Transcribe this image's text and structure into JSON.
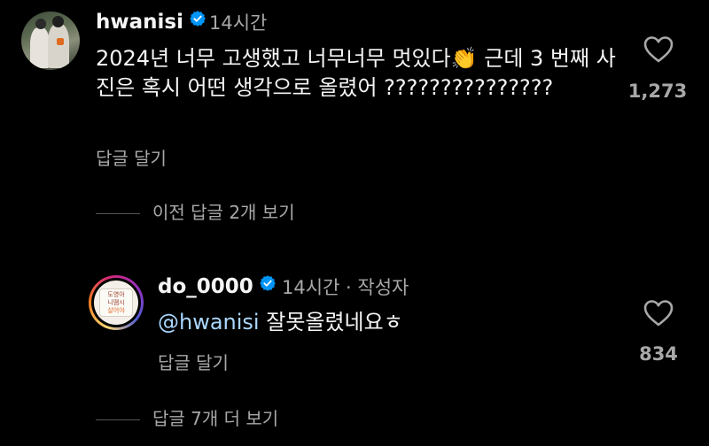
{
  "colors": {
    "background": "#000000",
    "text_primary": "#f5f5f5",
    "text_secondary": "#a8a8a8",
    "verified_badge": "#0095f6",
    "mention": "#aad7ff"
  },
  "comments": [
    {
      "username": "hwanisi",
      "verified": true,
      "time": "14시간",
      "text_before_emoji": "2024년 너무 고생했고 너무너무 멋있다",
      "emoji": "👏",
      "text_after_emoji": " 근데 3 번째 사진은 혹시 어떤 생각으로 올렸어 ???????????????",
      "reply_label": "답글 달기",
      "likes": "1,273",
      "like_icon": "heart-outline-icon",
      "avatar_icon": "profile-photo"
    }
  ],
  "view_previous": "이전 답글 2개 보기",
  "replies": [
    {
      "username": "do_0000",
      "verified": true,
      "time": "14시간",
      "author_tag": " · 작성자",
      "mention": "@hwanisi",
      "text": " 잘못올렸네요ㅎ",
      "reply_label": "답글 달기",
      "likes": "834",
      "like_icon": "heart-outline-icon",
      "avatar_sign_text": [
        "도영아",
        "니땜시",
        "살어야"
      ]
    }
  ],
  "view_more": "답글 7개 더 보기"
}
